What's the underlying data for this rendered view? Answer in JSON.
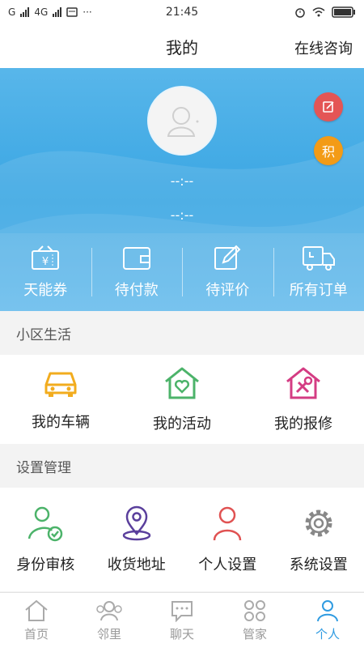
{
  "status_bar": {
    "carrier": "G",
    "network": "4G",
    "time": "21:45",
    "more": "···"
  },
  "header": {
    "title": "我的",
    "consult": "在线咨询"
  },
  "profile": {
    "name": "--:--",
    "sub": "--:--",
    "edit_icon": "edit-icon",
    "points_label": "积"
  },
  "quick_actions": [
    {
      "label": "天能券",
      "icon": "coupon-icon"
    },
    {
      "label": "待付款",
      "icon": "wallet-icon"
    },
    {
      "label": "待评价",
      "icon": "review-icon"
    },
    {
      "label": "所有订单",
      "icon": "delivery-truck-icon"
    }
  ],
  "community": {
    "title": "小区生活",
    "items": [
      {
        "label": "我的车辆",
        "icon": "car-icon"
      },
      {
        "label": "我的活动",
        "icon": "house-heart-icon"
      },
      {
        "label": "我的报修",
        "icon": "house-tools-icon"
      }
    ]
  },
  "settings": {
    "title": "设置管理",
    "items": [
      {
        "label": "身份审核",
        "icon": "user-check-icon"
      },
      {
        "label": "收货地址",
        "icon": "location-pin-icon"
      },
      {
        "label": "个人设置",
        "icon": "person-icon"
      },
      {
        "label": "系统设置",
        "icon": "gear-icon"
      }
    ]
  },
  "tabs": [
    {
      "label": "首页",
      "icon": "home-icon"
    },
    {
      "label": "邻里",
      "icon": "neighbors-icon"
    },
    {
      "label": "聊天",
      "icon": "chat-icon"
    },
    {
      "label": "管家",
      "icon": "grid-icon"
    },
    {
      "label": "个人",
      "icon": "person-icon",
      "active": true
    }
  ],
  "colors": {
    "hero": "#3aa6e3",
    "accent": "#2f9be1",
    "edit": "#e45555",
    "points": "#f39b16"
  }
}
